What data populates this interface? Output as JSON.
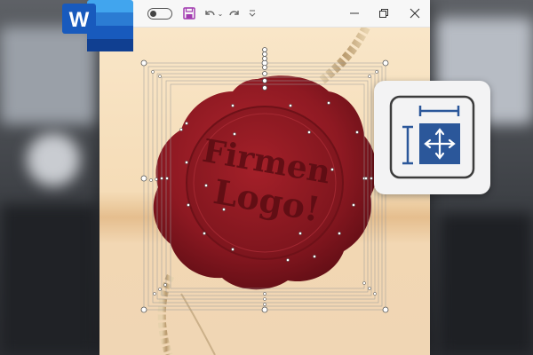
{
  "app": {
    "name": "Word",
    "logo_letter": "W",
    "accent_color": "#2b579a"
  },
  "titlebar": {
    "autosave_toggle": "off",
    "buttons": [
      "save-icon",
      "undo-icon",
      "redo-icon",
      "customize-qat-icon",
      "minimize-icon",
      "maximize-icon",
      "close-icon"
    ]
  },
  "document": {
    "seal_text_line1": "Firmen",
    "seal_text_line2": "Logo!",
    "seal_color": "#8b1a22",
    "background_color": "#f5dcb7"
  },
  "overlay": {
    "icon": "move-resize-icon",
    "icon_color": "#2b579a"
  }
}
